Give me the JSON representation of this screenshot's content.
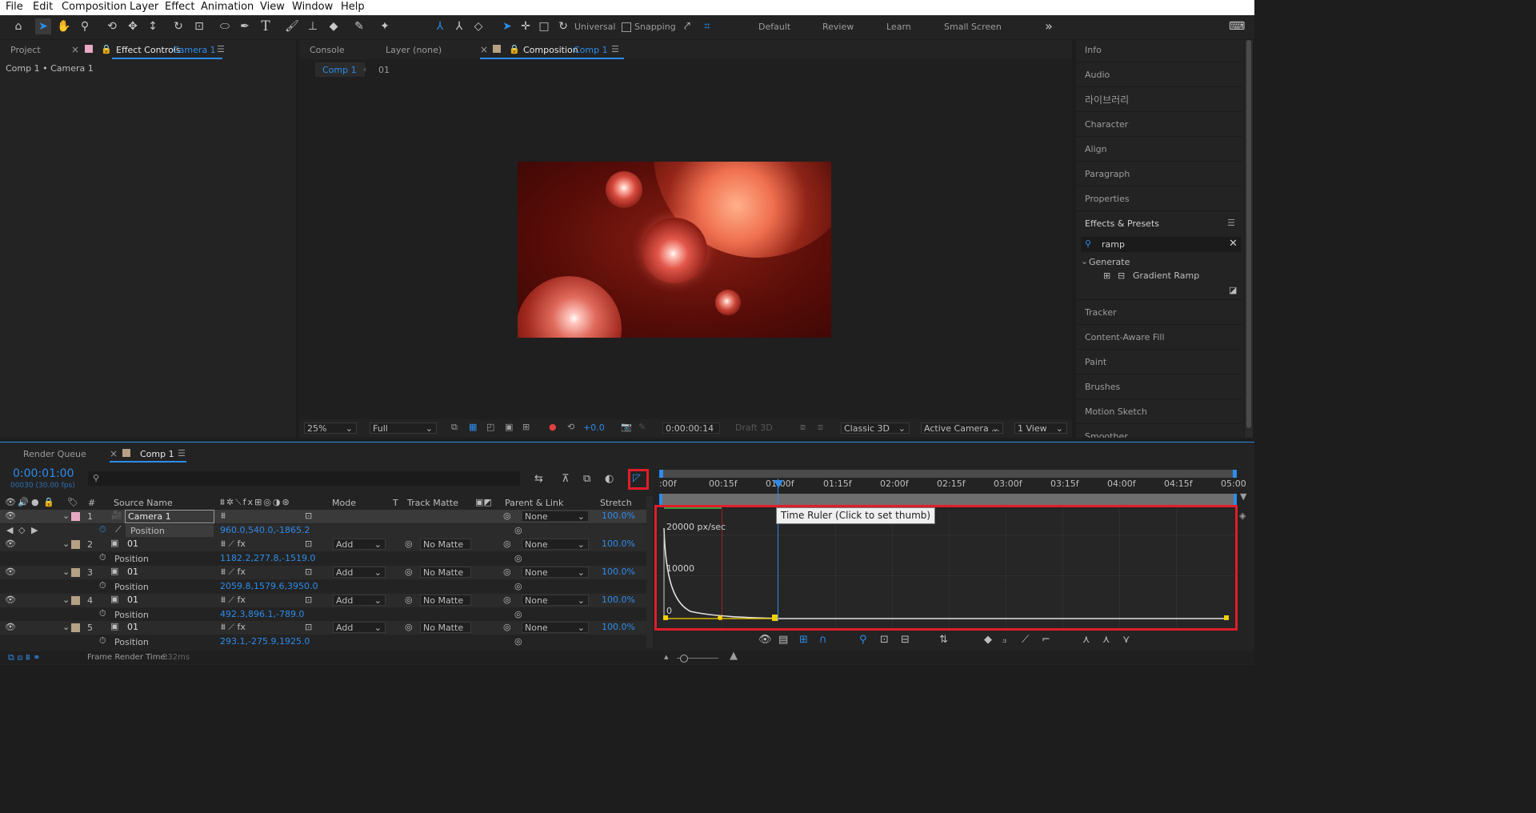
{
  "menu": [
    "File",
    "Edit",
    "Composition",
    "Layer",
    "Effect",
    "Animation",
    "View",
    "Window",
    "Help"
  ],
  "toolbar": {
    "universal": "Universal",
    "snapping": "Snapping",
    "workspaces": [
      "Default",
      "Review",
      "Learn",
      "Small Screen"
    ]
  },
  "left_panel": {
    "tab_project": "Project",
    "tab_effect_controls": "Effect Controls",
    "effect_target": "Camera 1",
    "breadcrumb": "Comp 1 • Camera 1"
  },
  "viewer": {
    "tab_console": "Console",
    "tab_layer": "Layer (none)",
    "tab_composition": "Composition",
    "comp_name": "Comp 1",
    "nav_comp": "Comp 1",
    "nav_layer": "01",
    "zoom": "25%",
    "resolution": "Full",
    "exposure": "+0.0",
    "timecode": "0:00:00:14",
    "draft3d": "Draft 3D",
    "renderer": "Classic 3D",
    "camera": "Active Camera ...",
    "views": "1 View"
  },
  "right_panel": {
    "items": [
      "Info",
      "Audio",
      "라이브러리",
      "Character",
      "Align",
      "Paragraph",
      "Properties"
    ],
    "effects_title": "Effects & Presets",
    "search": "ramp",
    "category": "Generate",
    "effect": "Gradient Ramp",
    "items2": [
      "Tracker",
      "Content-Aware Fill",
      "Paint",
      "Brushes",
      "Motion Sketch",
      "Smoother"
    ]
  },
  "timeline": {
    "tab_render_queue": "Render Queue",
    "tab_comp": "Comp 1",
    "current_time": "0:00:01:00",
    "frame_info": "00030 (30.00 fps)",
    "col_source": "Source Name",
    "col_mode": "Mode",
    "col_t": "T",
    "col_track": "Track Matte",
    "col_parent": "Parent & Link",
    "col_stretch": "Stretch",
    "layers": [
      {
        "num": "1",
        "name": "Camera 1",
        "prop": "Position",
        "value": "960.0,540.0,-1865.2",
        "mode": "",
        "matte": "",
        "parent": "None",
        "stretch": "100.0%"
      },
      {
        "num": "2",
        "name": "01",
        "prop": "Position",
        "value": "1182.2,277.8,-1519.0",
        "mode": "Add",
        "matte": "No Matte",
        "parent": "None",
        "stretch": "100.0%"
      },
      {
        "num": "3",
        "name": "01",
        "prop": "Position",
        "value": "2059.8,1579.6,3950.0",
        "mode": "Add",
        "matte": "No Matte",
        "parent": "None",
        "stretch": "100.0%"
      },
      {
        "num": "4",
        "name": "01",
        "prop": "Position",
        "value": "492.3,896.1,-789.0",
        "mode": "Add",
        "matte": "No Matte",
        "parent": "None",
        "stretch": "100.0%"
      },
      {
        "num": "5",
        "name": "01",
        "prop": "Position",
        "value": "293.1,-275.9,1925.0",
        "mode": "Add",
        "matte": "No Matte",
        "parent": "None",
        "stretch": "100.0%"
      }
    ],
    "ruler": [
      ":00f",
      "00:15f",
      "01:00f",
      "01:15f",
      "02:00f",
      "02:15f",
      "03:00f",
      "03:15f",
      "04:00f",
      "04:15f",
      "05:00"
    ],
    "tooltip": "Time Ruler (Click to set thumb)",
    "graph_labels": {
      "top": "20000 px/sec",
      "mid": "10000",
      "zero": "0"
    },
    "frame_render": "Frame Render Time:",
    "frame_render_value": "232ms"
  },
  "colors": {
    "accent": "#2d8ceb",
    "highlight_box": "#e01e2a",
    "keyframe": "#f5d000",
    "label_pink": "#e8a9c5",
    "label_tan": "#b5a185"
  }
}
